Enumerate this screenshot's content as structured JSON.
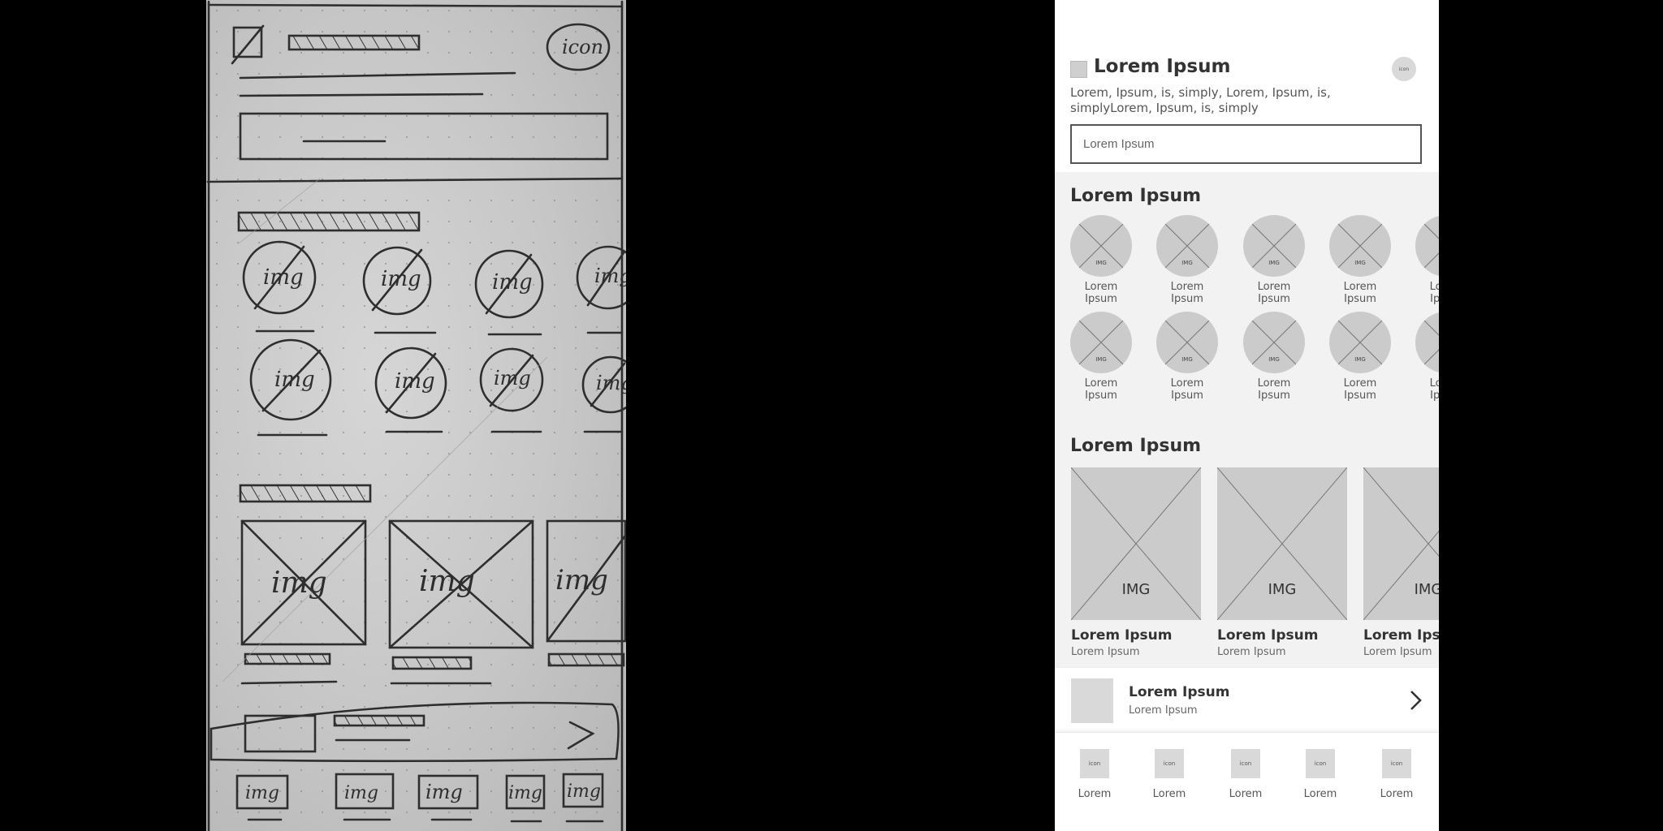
{
  "sketch": {
    "header_icon_text": "icon",
    "img_text": "img"
  },
  "phone": {
    "header": {
      "title": "Lorem Ipsum",
      "icon_text": "icon",
      "subtitle": "Lorem, Ipsum, is, simply, Lorem, Ipsum, is, simplyLorem, Ipsum, is, simply",
      "search_placeholder": "Lorem Ipsum"
    },
    "categories": {
      "title": "Lorem Ipsum",
      "img_tag": "IMG",
      "row1": [
        "Lorem Ipsum",
        "Lorem Ipsum",
        "Lorem Ipsum",
        "Lorem Ipsum",
        "Lorem Ipsum"
      ],
      "row2": [
        "Lorem Ipsum",
        "Lorem Ipsum",
        "Lorem Ipsum",
        "Lorem Ipsum",
        "Lorem Ipsum"
      ]
    },
    "products": {
      "title": "Lorem Ipsum",
      "img_tag": "IMG",
      "items": [
        {
          "title": "Lorem Ipsum",
          "sub": "Lorem Ipsum"
        },
        {
          "title": "Lorem Ipsum",
          "sub": "Lorem Ipsum"
        },
        {
          "title": "Lorem Ipsum",
          "sub": "Lorem Ipsum"
        }
      ]
    },
    "promo": {
      "title": "Lorem Ipsum",
      "sub": "Lorem Ipsum"
    },
    "tabbar": {
      "icon_text": "icon",
      "labels": [
        "Lorem",
        "Lorem",
        "Lorem",
        "Lorem",
        "Lorem"
      ]
    }
  }
}
